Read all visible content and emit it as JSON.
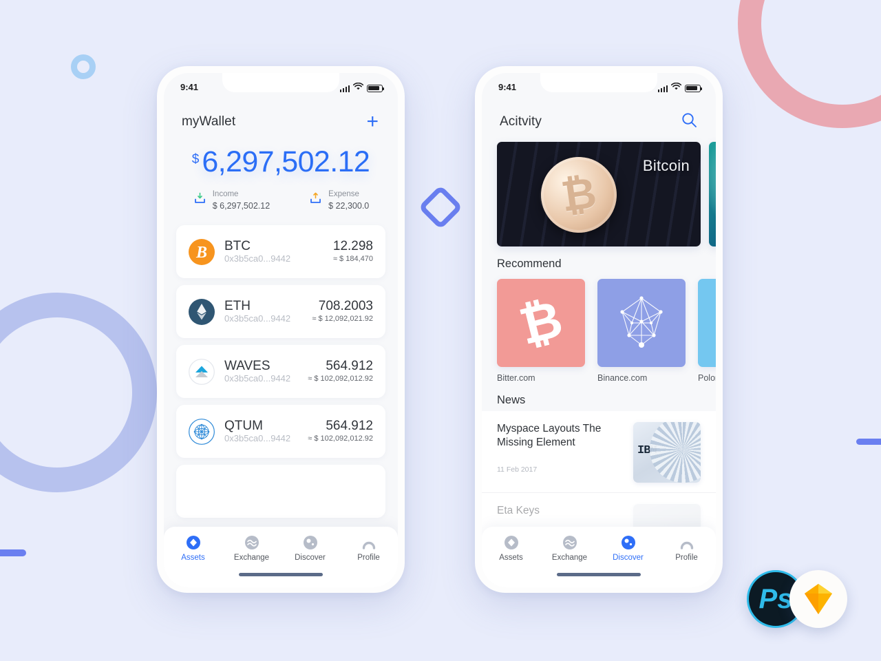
{
  "colors": {
    "page_background": "#e8ecfb",
    "accent_blue": "#2e6ef7",
    "ring_pink": "#e9a8b2",
    "ring_periwinkle": "#b7c2ee",
    "ring_small_blue": "#a8d0f5",
    "diamond": "#6a7ff0",
    "income_arrow": "#3cc98a",
    "expense_arrow": "#f5a623",
    "btc_orange": "#f7941e",
    "eth_navy": "#2f5673",
    "waves_cyan": "#1ca6dd",
    "qtum_blue": "#2e8ad8",
    "card_bitter": "#f29a96",
    "card_binance": "#8e9fe6",
    "card_poloniex": "#74c7f0"
  },
  "status_bar": {
    "time": "9:41",
    "signal_icon": "cellular-signal-icon",
    "wifi_icon": "wifi-icon",
    "battery_icon": "battery-icon"
  },
  "assets_screen": {
    "header": {
      "title": "myWallet",
      "add_icon": "plus-icon"
    },
    "balance": {
      "currency_symbol": "$",
      "amount": "6,297,502.12"
    },
    "income": {
      "label": "Income",
      "value": "$ 6,297,502.12",
      "icon": "income-tray-down-icon"
    },
    "expense": {
      "label": "Expense",
      "value": "$ 22,300.0",
      "icon": "expense-tray-up-icon"
    },
    "assets": [
      {
        "symbol": "BTC",
        "address": "0x3b5ca0...9442",
        "amount": "12.298",
        "fiat": "≈ $ 184,470",
        "icon": "btc-coin-icon"
      },
      {
        "symbol": "ETH",
        "address": "0x3b5ca0...9442",
        "amount": "708.2003",
        "fiat": "≈ $ 12,092,021.92",
        "icon": "eth-coin-icon"
      },
      {
        "symbol": "WAVES",
        "address": "0x3b5ca0...9442",
        "amount": "564.912",
        "fiat": "≈ $ 102,092,012.92",
        "icon": "waves-coin-icon"
      },
      {
        "symbol": "QTUM",
        "address": "0x3b5ca0...9442",
        "amount": "564.912",
        "fiat": "≈ $ 102,092,012.92",
        "icon": "qtum-coin-icon"
      }
    ],
    "tabs": [
      {
        "label": "Assets",
        "icon": "assets-diamond-icon",
        "active": true
      },
      {
        "label": "Exchange",
        "icon": "exchange-waves-icon",
        "active": false
      },
      {
        "label": "Discover",
        "icon": "discover-moon-icon",
        "active": false
      },
      {
        "label": "Profile",
        "icon": "profile-person-icon",
        "active": false
      }
    ]
  },
  "discover_screen": {
    "header": {
      "title": "Acitvity",
      "search_icon": "search-icon"
    },
    "banners": [
      {
        "label": "Bitcoin",
        "image": "bitcoin-coin-on-keyboard-photo"
      },
      {
        "label": "",
        "image": "teal-abstract-photo"
      }
    ],
    "recommend": {
      "section_title": "Recommend",
      "items": [
        {
          "name": "Bitter.com",
          "icon": "bitcoin-b-icon",
          "color": "#f29a96"
        },
        {
          "name": "Binance.com",
          "icon": "network-polyhedron-icon",
          "color": "#8e9fe6"
        },
        {
          "name": "Polonie",
          "icon": "poloniex-icon",
          "color": "#74c7f0"
        }
      ]
    },
    "news": {
      "section_title": "News",
      "items": [
        {
          "title": "Myspace Layouts The Missing Element",
          "date": "11 Feb 2017",
          "thumb": "ibm-server-thumbnail"
        },
        {
          "title": "Eta Keys",
          "date": "",
          "thumb": "portrait-thumbnail"
        }
      ]
    },
    "tabs": [
      {
        "label": "Assets",
        "icon": "assets-diamond-icon",
        "active": false
      },
      {
        "label": "Exchange",
        "icon": "exchange-waves-icon",
        "active": false
      },
      {
        "label": "Discover",
        "icon": "discover-moon-icon",
        "active": true
      },
      {
        "label": "Profile",
        "icon": "profile-person-icon",
        "active": false
      }
    ]
  },
  "app_logos": [
    {
      "name": "Ps",
      "label": "photoshop-logo"
    },
    {
      "name": "",
      "label": "sketch-logo"
    }
  ]
}
